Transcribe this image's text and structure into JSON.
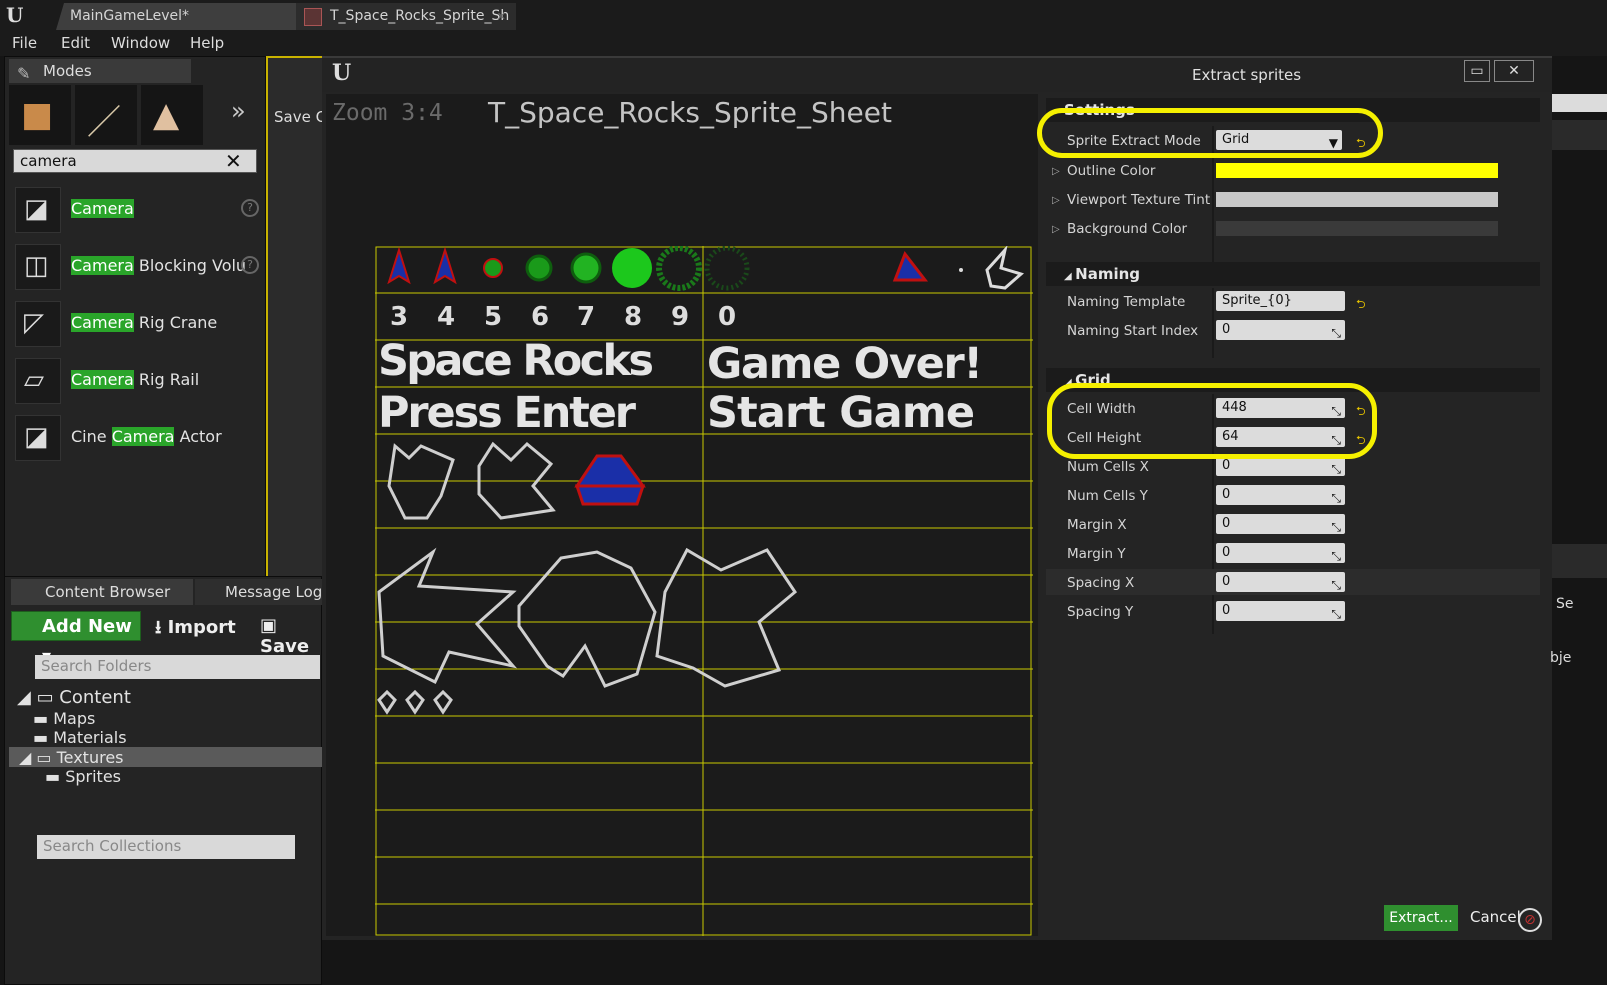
{
  "titlebar": {
    "tab1": "MainGameLevel*",
    "tab2": "T_Space_Rocks_Sprite_Sh"
  },
  "menu": [
    "File",
    "Edit",
    "Window",
    "Help"
  ],
  "modes": {
    "tab_label": "Modes",
    "search_value": "camera",
    "toolbar_button": "Save C",
    "results": [
      {
        "highlight": "Camera",
        "before": "",
        "after": ""
      },
      {
        "highlight": "Camera",
        "before": "",
        "after": " Blocking Volu"
      },
      {
        "highlight": "Camera",
        "before": "",
        "after": " Rig Crane"
      },
      {
        "highlight": "Camera",
        "before": "",
        "after": " Rig Rail"
      },
      {
        "highlight": "Camera",
        "before": "Cine ",
        "after": " Actor"
      }
    ]
  },
  "content_browser": {
    "tab1": "Content Browser",
    "tab2": "Message Log",
    "add_new": "Add New",
    "import": "Import",
    "save": "Save",
    "folder_search_placeholder": "Search Folders",
    "tree": [
      "Content",
      "Maps",
      "Materials",
      "Textures",
      "Sprites"
    ],
    "collections_placeholder": "Search Collections"
  },
  "dialog": {
    "title": "Extract sprites",
    "zoom": "Zoom 3:4",
    "texture_name": "T_Space_Rocks_Sprite_Sheet",
    "sprite_text": {
      "digits": [
        "3",
        "4",
        "5",
        "6",
        "7",
        "8",
        "9",
        "0"
      ],
      "space_rocks": "Space Rocks",
      "game_over": "Game Over!",
      "press_enter": "Press Enter",
      "start_game": "Start Game"
    },
    "settings": {
      "header": "Settings",
      "sprite_extract_mode_label": "Sprite Extract Mode",
      "sprite_extract_mode_value": "Grid",
      "outline_color_label": "Outline Color",
      "outline_color": "#ffff00",
      "viewport_tint_label": "Viewport Texture Tint",
      "background_color_label": "Background Color"
    },
    "naming": {
      "header": "Naming",
      "template_label": "Naming Template",
      "template_value": "Sprite_{0}",
      "start_index_label": "Naming Start Index",
      "start_index_value": "0"
    },
    "grid": {
      "header": "Grid",
      "fields": [
        {
          "label": "Cell Width",
          "value": "448"
        },
        {
          "label": "Cell Height",
          "value": "64"
        },
        {
          "label": "Num Cells X",
          "value": "0"
        },
        {
          "label": "Num Cells Y",
          "value": "0"
        },
        {
          "label": "Margin X",
          "value": "0"
        },
        {
          "label": "Margin Y",
          "value": "0"
        },
        {
          "label": "Spacing X",
          "value": "0"
        },
        {
          "label": "Spacing Y",
          "value": "0"
        }
      ]
    },
    "extract_button": "Extract...",
    "cancel_button": "Cancel"
  },
  "edge_text": {
    "se": "Se",
    "bje": "bje"
  },
  "colors": {
    "highlight": "#2aa52a",
    "annotation": "#f5f000",
    "grid_line": "#c8c800"
  }
}
